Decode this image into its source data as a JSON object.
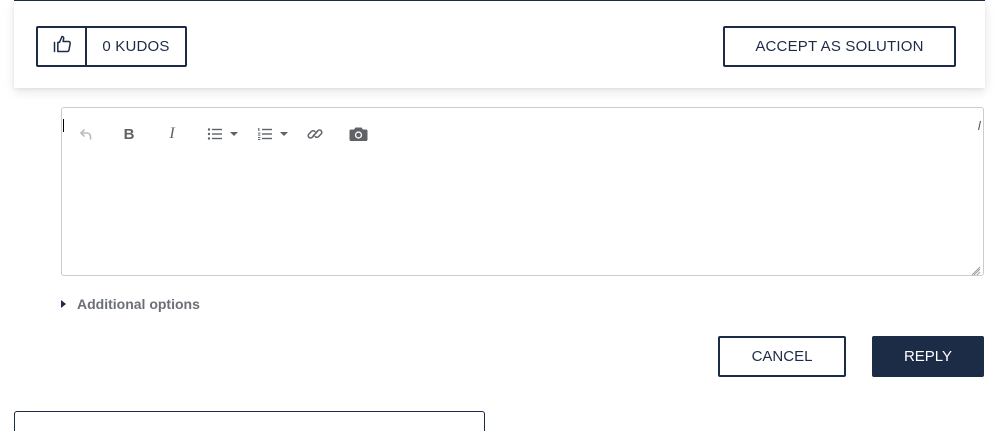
{
  "kudos": {
    "count_label": "0 KUDOS",
    "icon": "thumbs-up-icon"
  },
  "solution": {
    "accept_label": "ACCEPT AS SOLUTION"
  },
  "editor": {
    "toolbar": [
      {
        "name": "undo",
        "icon": "undo-icon"
      },
      {
        "name": "bold",
        "icon": "bold-icon",
        "glyph": "B"
      },
      {
        "name": "italic",
        "icon": "italic-icon",
        "glyph": "I"
      },
      {
        "name": "bulleted-list",
        "icon": "bulleted-list-icon"
      },
      {
        "name": "numbered-list",
        "icon": "numbered-list-icon"
      },
      {
        "name": "link",
        "icon": "link-icon"
      },
      {
        "name": "insert-photo",
        "icon": "camera-icon"
      }
    ],
    "content": ""
  },
  "additional_options": {
    "label": "Additional options"
  },
  "actions": {
    "cancel_label": "CANCEL",
    "reply_label": "REPLY"
  },
  "colors": {
    "brand_navy": "#1c2b46",
    "muted_text": "#6b6f77",
    "editor_border": "#c9ccd1",
    "toolbar_icon": "#6b6b6b"
  }
}
